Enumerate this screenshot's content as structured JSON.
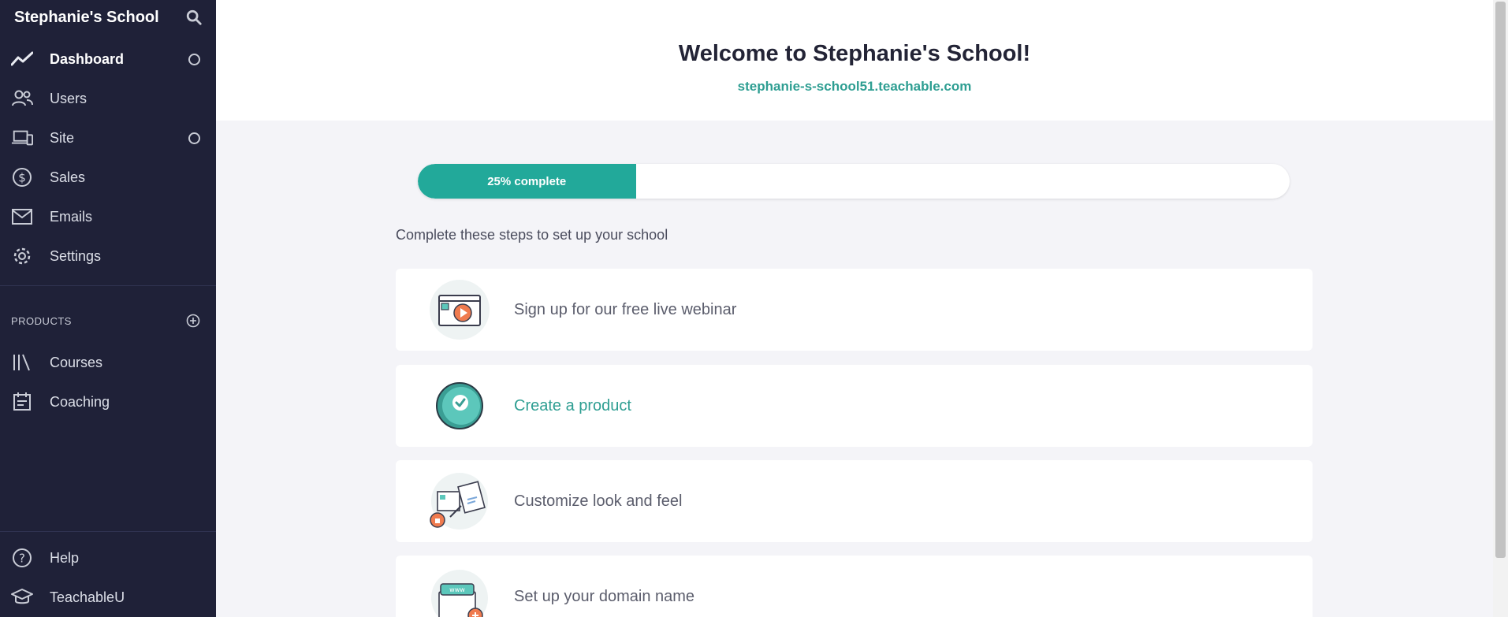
{
  "sidebar": {
    "school_name": "Stephanie's School",
    "nav": [
      {
        "label": "Dashboard",
        "icon": "trend-line-icon"
      },
      {
        "label": "Users",
        "icon": "users-icon"
      },
      {
        "label": "Site",
        "icon": "devices-icon"
      },
      {
        "label": "Sales",
        "icon": "dollar-circle-icon"
      },
      {
        "label": "Emails",
        "icon": "envelope-icon"
      },
      {
        "label": "Settings",
        "icon": "gear-icon"
      }
    ],
    "products_label": "PRODUCTS",
    "products": [
      {
        "label": "Courses",
        "icon": "library-icon"
      },
      {
        "label": "Coaching",
        "icon": "calendar-icon"
      }
    ],
    "bottom": [
      {
        "label": "Help",
        "icon": "help-circle-icon"
      },
      {
        "label": "TeachableU",
        "icon": "graduation-cap-icon"
      }
    ]
  },
  "hero": {
    "title": "Welcome to Stephanie's School!",
    "url": "stephanie-s-school51.teachable.com"
  },
  "progress": {
    "percent": 25,
    "label": "25% complete"
  },
  "steps_intro": "Complete these steps to set up your school",
  "steps": [
    {
      "label": "Sign up for our free live webinar"
    },
    {
      "label": "Create a product"
    },
    {
      "label": "Customize look and feel"
    },
    {
      "label": "Set up your domain name"
    }
  ],
  "colors": {
    "sidebar_bg": "#1f2138",
    "accent": "#22a99a",
    "link": "#2e9e92"
  }
}
